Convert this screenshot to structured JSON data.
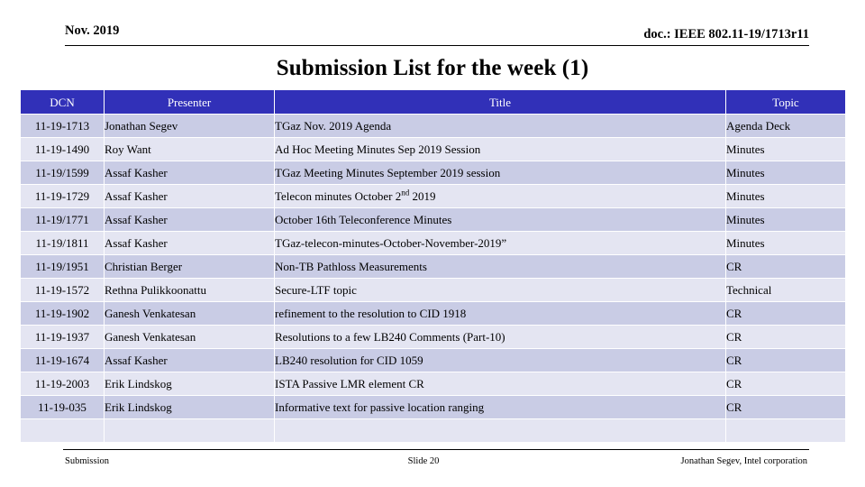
{
  "header": {
    "date": "Nov. 2019",
    "doc": "doc.: IEEE 802.11-19/1713r11"
  },
  "title": "Submission List for the week (1)",
  "table": {
    "columns": [
      {
        "key": "dcn",
        "label": "DCN"
      },
      {
        "key": "presenter",
        "label": "Presenter"
      },
      {
        "key": "title",
        "label": "Title"
      },
      {
        "key": "topic",
        "label": "Topic"
      }
    ],
    "header_bg": "#3130B8",
    "header_fg": "#FFFFFF",
    "band_dark": "#C9CCE5",
    "band_light": "#E4E5F2",
    "rows": [
      {
        "dcn": "11-19-1713",
        "presenter": "Jonathan Segev",
        "title": "TGaz Nov. 2019 Agenda",
        "topic": "Agenda Deck"
      },
      {
        "dcn": "11-19-1490",
        "presenter": "Roy Want",
        "title": "Ad Hoc Meeting Minutes Sep 2019 Session",
        "topic": "Minutes"
      },
      {
        "dcn": "11-19/1599",
        "presenter": "Assaf Kasher",
        "title": "TGaz Meeting Minutes September 2019 session",
        "topic": "Minutes"
      },
      {
        "dcn": "11-19-1729",
        "presenter": "Assaf Kasher",
        "title_pre": "Telecon minutes October 2",
        "title_sup": "nd",
        "title_post": " 2019",
        "title": "Telecon minutes October 2nd 2019",
        "topic": "Minutes"
      },
      {
        "dcn": "11-19/1771",
        "presenter": "Assaf Kasher",
        "title": "October 16th Teleconference Minutes",
        "topic": "Minutes"
      },
      {
        "dcn": "11-19/1811",
        "presenter": "Assaf Kasher",
        "title": "TGaz-telecon-minutes-October-November-2019”",
        "topic": "Minutes"
      },
      {
        "dcn": "11-19/1951",
        "presenter": "Christian Berger",
        "title": "Non-TB Pathloss Measurements",
        "topic": "CR"
      },
      {
        "dcn": "11-19-1572",
        "presenter": "Rethna Pulikkoonattu",
        "title": "Secure-LTF topic",
        "topic": "Technical"
      },
      {
        "dcn": "11-19-1902",
        "presenter": "Ganesh Venkatesan",
        "title": "refinement to the resolution to CID 1918",
        "topic": "CR"
      },
      {
        "dcn": "11-19-1937",
        "presenter": "Ganesh Venkatesan",
        "title": "Resolutions to a few LB240 Comments (Part-10)",
        "topic": "CR"
      },
      {
        "dcn": "11-19-1674",
        "presenter": "Assaf Kasher",
        "title": "LB240 resolution for CID 1059",
        "topic": "CR"
      },
      {
        "dcn": "11-19-2003",
        "presenter": "Erik Lindskog",
        "title": "ISTA Passive LMR element CR",
        "topic": "CR"
      },
      {
        "dcn": "11-19-035",
        "presenter": "Erik Lindskog",
        "title": "Informative text for passive location ranging",
        "topic": "CR"
      },
      {
        "dcn": "",
        "presenter": "",
        "title": "",
        "topic": ""
      }
    ]
  },
  "footer": {
    "left": "Submission",
    "center": "Slide 20",
    "right": "Jonathan Segev, Intel corporation"
  }
}
